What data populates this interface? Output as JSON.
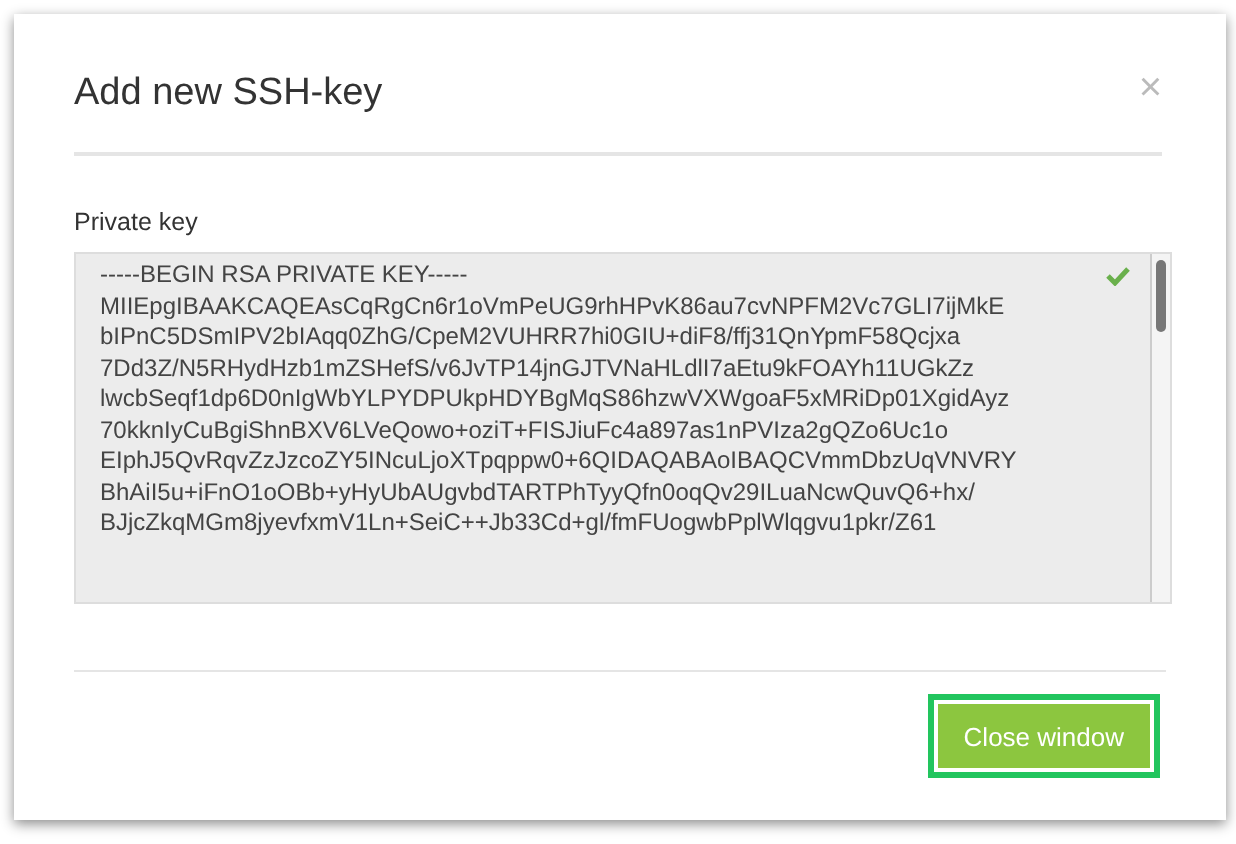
{
  "dialog": {
    "title": "Add new SSH-key",
    "close": "×"
  },
  "private_key": {
    "label": "Private key",
    "valid": true,
    "lines": [
      "-----BEGIN RSA PRIVATE KEY-----",
      "MIIEpgIBAAKCAQEAsCqRgCn6r1oVmPeUG9rhHPvK86au7cvNPFM2Vc7GLI7ijMkE",
      "bIPnC5DSmIPV2bIAqq0ZhG/CpeM2VUHRR7hi0GIU+diF8/ffj31QnYpmF58Qcjxa",
      "7Dd3Z/N5RHydHzb1mZSHefS/v6JvTP14jnGJTVNaHLdlI7aEtu9kFOAYh11UGkZz",
      "lwcbSeqf1dp6D0nIgWbYLPYDPUkpHDYBgMqS86hzwVXWgoaF5xMRiDp01XgidAyz",
      "70kknIyCuBgiShnBXV6LVeQowo+oziT+FISJiuFc4a897as1nPVIza2gQZo6Uc1o",
      "EIphJ5QvRqvZzJzcoZY5INcuLjoXTpqppw0+6QIDAQABAoIBAQCVmmDbzUqVNVRY",
      "BhAiI5u+iFnO1oOBb+yHyUbAUgvbdTARTPhTyyQfn0oqQv29ILuaNcwQuvQ6+hx/",
      "BJjcZkqMGm8jyevfxmV1Ln+SeiC++Jb33Cd+gl/fmFUogwbPplWlqgvu1pkr/Z61"
    ]
  },
  "footer": {
    "button": {
      "label": "Close window",
      "focused": true
    }
  }
}
